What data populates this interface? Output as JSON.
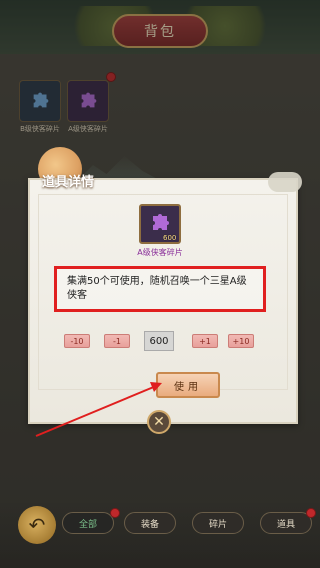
{
  "header": {
    "title": "背包"
  },
  "inventory": {
    "items": [
      {
        "label": "B级侠客碎片",
        "icon": "puzzle-icon-blue"
      },
      {
        "label": "A级侠客碎片",
        "icon": "puzzle-icon-purple"
      }
    ]
  },
  "dialog": {
    "title": "道具详情",
    "item_icon": "puzzle-icon-purple",
    "item_badge": "600",
    "item_name": "A级侠客碎片",
    "description": "集满50个可使用，随机召唤一个三星A级侠客",
    "quantity": {
      "minus10": "-10",
      "minus1": "-1",
      "value": "600",
      "plus1": "+1",
      "plus10": "+10"
    },
    "use_label": "使用",
    "close_icon": "close-icon"
  },
  "bottom_tabs": [
    {
      "label": "全部",
      "active": true
    },
    {
      "label": "装备",
      "active": false
    },
    {
      "label": "碎片",
      "active": false
    },
    {
      "label": "道具",
      "active": false
    }
  ],
  "colors": {
    "highlight_box": "#e01f1f",
    "arrow": "#e01f1f",
    "item_name": "#8a2f9a"
  }
}
